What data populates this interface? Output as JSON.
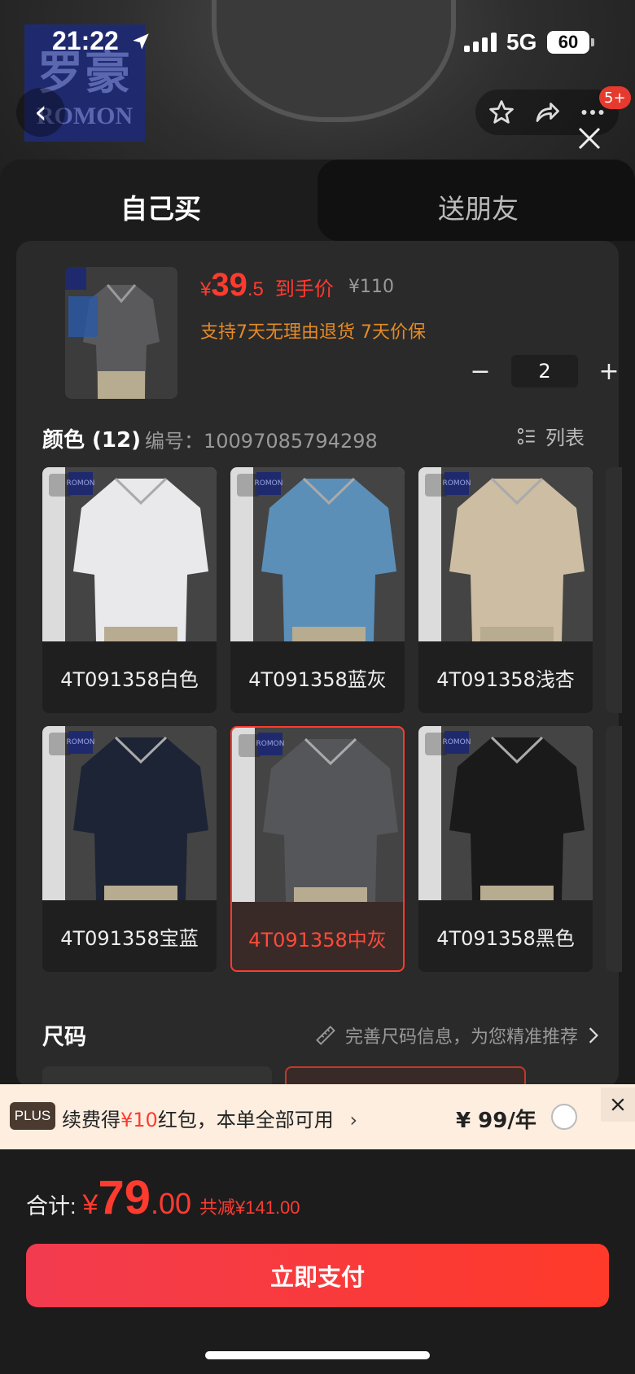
{
  "status_bar": {
    "time": "21:22",
    "network": "5G",
    "battery": "60"
  },
  "header": {
    "badge_count": "5+"
  },
  "brand": {
    "logo_cn": "罗豪",
    "logo_en": "ROMON"
  },
  "tabs": [
    {
      "label": "自己买",
      "active": true
    },
    {
      "label": "送朋友",
      "active": false
    }
  ],
  "product": {
    "price_symbol": "¥",
    "price_int": "39",
    "price_dec": ".5",
    "price_tag": "到手价",
    "original_price": "¥110",
    "guarantee": "支持7天无理由退货  7天价保",
    "quantity": "2"
  },
  "colors": {
    "title": "颜色 (12)",
    "code": "编号：10097085794298",
    "list_toggle": "列表",
    "items": [
      {
        "label": "4T091358白色",
        "shirt_color": "#e9e9ec",
        "selected": false
      },
      {
        "label": "4T091358蓝灰",
        "shirt_color": "#5b8fb8",
        "selected": false
      },
      {
        "label": "4T091358浅杏",
        "shirt_color": "#cdbda3",
        "selected": false
      },
      {
        "label": "4T091358宝蓝",
        "shirt_color": "#1d2436",
        "selected": false
      },
      {
        "label": "4T091358中灰",
        "shirt_color": "#555659",
        "selected": true
      },
      {
        "label": "4T091358黑色",
        "shirt_color": "#1a1a1a",
        "selected": false
      }
    ]
  },
  "size": {
    "title": "尺码",
    "hint": "完善尺码信息，为您精准推荐"
  },
  "plus_bar": {
    "badge": "PLUS",
    "text_pre": "续费得",
    "text_red": "¥10",
    "text_post": "红包，本单全部可用",
    "price": "¥ 99/年"
  },
  "footer": {
    "total_label": "合计:",
    "currency": "¥",
    "total_int": "79",
    "total_dec": ".00",
    "savings": "共减¥141.00",
    "pay_button": "立即支付"
  },
  "colors_theme": {
    "accent": "#ff3b30",
    "orange": "#e58a25",
    "sheet_bg": "#1c1c1c"
  }
}
